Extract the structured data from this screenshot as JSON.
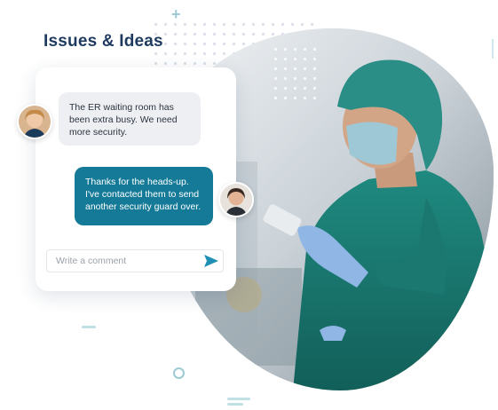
{
  "header": {
    "title": "Issues & Ideas"
  },
  "chat": {
    "incoming_message": "The ER waiting room has\nbeen extra busy. We need\nmore security.",
    "outgoing_message": "Thanks for the heads-up.\nI've contacted them to send\nanother security guard over.",
    "comment_placeholder": "Write a comment",
    "comment_value": ""
  },
  "icons": {
    "send": "send-icon",
    "sender_avatar": "avatar-icon",
    "responder_avatar": "avatar-icon"
  },
  "colors": {
    "title": "#1e3a5f",
    "accent": "#147a97",
    "send_icon": "#1f8fb3",
    "incoming_bubble": "#eeeff2",
    "scrubs": "#1d7f76"
  }
}
